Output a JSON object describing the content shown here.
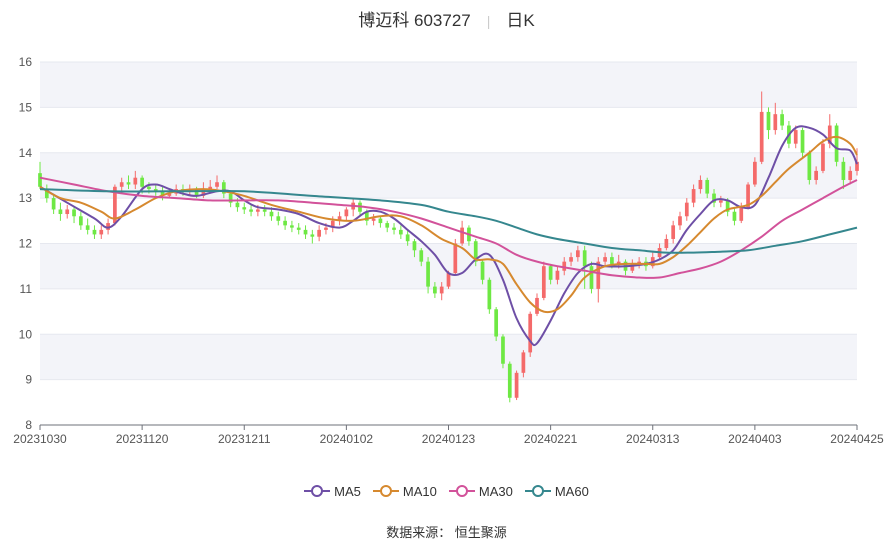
{
  "header": {
    "name": "博迈科",
    "code": "603727",
    "period": "日K"
  },
  "source": "数据来源： 恒生聚源",
  "colors": {
    "up": "#f46a6a",
    "down": "#6ee844",
    "band": "#f3f4f9",
    "grid": "#e6e8ef"
  },
  "chart_data": {
    "type": "candlestick",
    "ylim": [
      8,
      16
    ],
    "yticks": [
      8,
      9,
      10,
      11,
      12,
      13,
      14,
      15,
      16
    ],
    "xlabels": [
      "20231030",
      "20231120",
      "20231211",
      "20240102",
      "20240123",
      "20240221",
      "20240313",
      "20240403",
      "20240425"
    ],
    "xlabel_index": [
      0,
      15,
      30,
      45,
      60,
      75,
      90,
      105,
      120
    ],
    "n_days": 121,
    "candles": [
      [
        13.55,
        13.25,
        13.8,
        13.2
      ],
      [
        13.2,
        13.0,
        13.3,
        12.9
      ],
      [
        13.0,
        12.75,
        13.1,
        12.65
      ],
      [
        12.75,
        12.65,
        12.9,
        12.5
      ],
      [
        12.65,
        12.75,
        12.85,
        12.55
      ],
      [
        12.75,
        12.6,
        12.8,
        12.45
      ],
      [
        12.6,
        12.4,
        12.7,
        12.3
      ],
      [
        12.4,
        12.3,
        12.55,
        12.2
      ],
      [
        12.3,
        12.2,
        12.4,
        12.1
      ],
      [
        12.2,
        12.3,
        12.4,
        12.1
      ],
      [
        12.3,
        12.45,
        12.55,
        12.2
      ],
      [
        12.45,
        13.25,
        13.3,
        12.4
      ],
      [
        13.25,
        13.35,
        13.45,
        13.1
      ],
      [
        13.35,
        13.3,
        13.5,
        13.2
      ],
      [
        13.3,
        13.45,
        13.6,
        13.2
      ],
      [
        13.45,
        13.25,
        13.5,
        13.1
      ],
      [
        13.25,
        13.2,
        13.35,
        13.1
      ],
      [
        13.2,
        13.15,
        13.3,
        13.05
      ],
      [
        13.15,
        13.05,
        13.25,
        12.95
      ],
      [
        13.05,
        13.1,
        13.2,
        13.0
      ],
      [
        13.1,
        13.2,
        13.3,
        13.05
      ],
      [
        13.2,
        13.15,
        13.3,
        13.05
      ],
      [
        13.15,
        13.2,
        13.3,
        13.05
      ],
      [
        13.2,
        13.05,
        13.25,
        13.0
      ],
      [
        13.05,
        13.2,
        13.35,
        13.0
      ],
      [
        13.2,
        13.25,
        13.4,
        13.1
      ],
      [
        13.25,
        13.35,
        13.5,
        13.2
      ],
      [
        13.35,
        13.1,
        13.4,
        13.0
      ],
      [
        13.1,
        12.9,
        13.15,
        12.8
      ],
      [
        12.9,
        12.8,
        13.0,
        12.7
      ],
      [
        12.8,
        12.75,
        12.9,
        12.65
      ],
      [
        12.75,
        12.7,
        12.85,
        12.6
      ],
      [
        12.7,
        12.75,
        12.85,
        12.6
      ],
      [
        12.75,
        12.7,
        12.85,
        12.6
      ],
      [
        12.7,
        12.6,
        12.8,
        12.5
      ],
      [
        12.6,
        12.5,
        12.7,
        12.4
      ],
      [
        12.5,
        12.4,
        12.6,
        12.3
      ],
      [
        12.4,
        12.35,
        12.5,
        12.25
      ],
      [
        12.35,
        12.3,
        12.45,
        12.2
      ],
      [
        12.3,
        12.2,
        12.4,
        12.1
      ],
      [
        12.2,
        12.15,
        12.3,
        12.0
      ],
      [
        12.15,
        12.3,
        12.4,
        12.05
      ],
      [
        12.3,
        12.35,
        12.45,
        12.2
      ],
      [
        12.35,
        12.5,
        12.6,
        12.25
      ],
      [
        12.5,
        12.6,
        12.7,
        12.4
      ],
      [
        12.6,
        12.75,
        12.8,
        12.5
      ],
      [
        12.75,
        12.9,
        13.0,
        12.6
      ],
      [
        12.9,
        12.7,
        12.95,
        12.6
      ],
      [
        12.7,
        12.5,
        12.75,
        12.4
      ],
      [
        12.5,
        12.55,
        12.65,
        12.4
      ],
      [
        12.55,
        12.45,
        12.6,
        12.35
      ],
      [
        12.45,
        12.35,
        12.5,
        12.25
      ],
      [
        12.35,
        12.3,
        12.45,
        12.2
      ],
      [
        12.3,
        12.2,
        12.4,
        12.1
      ],
      [
        12.2,
        12.05,
        12.3,
        11.95
      ],
      [
        12.05,
        11.85,
        12.1,
        11.7
      ],
      [
        11.85,
        11.6,
        11.9,
        11.5
      ],
      [
        11.6,
        11.05,
        11.7,
        10.9
      ],
      [
        11.05,
        10.9,
        11.15,
        10.8
      ],
      [
        10.9,
        11.05,
        11.15,
        10.75
      ],
      [
        11.05,
        11.35,
        11.4,
        11.0
      ],
      [
        11.35,
        12.0,
        12.1,
        11.3
      ],
      [
        12.0,
        12.35,
        12.5,
        11.95
      ],
      [
        12.35,
        12.05,
        12.4,
        11.95
      ],
      [
        12.05,
        11.6,
        12.1,
        11.5
      ],
      [
        11.6,
        11.2,
        11.65,
        11.1
      ],
      [
        11.2,
        10.55,
        11.25,
        10.45
      ],
      [
        10.55,
        9.95,
        10.6,
        9.85
      ],
      [
        9.95,
        9.35,
        10.0,
        9.25
      ],
      [
        9.35,
        8.6,
        9.4,
        8.5
      ],
      [
        8.6,
        9.15,
        9.2,
        8.55
      ],
      [
        9.15,
        9.6,
        9.65,
        9.05
      ],
      [
        9.6,
        10.45,
        10.5,
        9.5
      ],
      [
        10.45,
        10.8,
        10.9,
        10.4
      ],
      [
        10.8,
        11.5,
        11.6,
        10.75
      ],
      [
        11.5,
        11.2,
        11.55,
        11.1
      ],
      [
        11.2,
        11.4,
        11.5,
        11.1
      ],
      [
        11.4,
        11.6,
        11.7,
        11.3
      ],
      [
        11.6,
        11.7,
        11.8,
        11.5
      ],
      [
        11.7,
        11.85,
        11.95,
        11.6
      ],
      [
        11.85,
        11.5,
        11.95,
        11.0
      ],
      [
        11.5,
        11.0,
        11.6,
        10.9
      ],
      [
        11.0,
        11.6,
        11.7,
        10.7
      ],
      [
        11.6,
        11.7,
        11.8,
        11.5
      ],
      [
        11.7,
        11.55,
        11.8,
        11.45
      ],
      [
        11.55,
        11.6,
        11.75,
        11.45
      ],
      [
        11.6,
        11.4,
        11.65,
        11.3
      ],
      [
        11.4,
        11.55,
        11.65,
        11.35
      ],
      [
        11.55,
        11.6,
        11.7,
        11.45
      ],
      [
        11.6,
        11.5,
        11.7,
        11.4
      ],
      [
        11.5,
        11.7,
        11.8,
        11.45
      ],
      [
        11.7,
        11.9,
        12.0,
        11.65
      ],
      [
        11.9,
        12.1,
        12.2,
        11.85
      ],
      [
        12.1,
        12.4,
        12.5,
        12.0
      ],
      [
        12.4,
        12.6,
        12.7,
        12.3
      ],
      [
        12.6,
        12.9,
        13.0,
        12.5
      ],
      [
        12.9,
        13.2,
        13.3,
        12.8
      ],
      [
        13.2,
        13.4,
        13.5,
        13.1
      ],
      [
        13.4,
        13.1,
        13.45,
        13.0
      ],
      [
        13.1,
        12.9,
        13.2,
        12.8
      ],
      [
        12.9,
        12.95,
        13.05,
        12.8
      ],
      [
        12.95,
        12.7,
        13.0,
        12.6
      ],
      [
        12.7,
        12.5,
        12.8,
        12.4
      ],
      [
        12.5,
        12.8,
        12.9,
        12.45
      ],
      [
        12.8,
        13.3,
        13.35,
        12.75
      ],
      [
        13.3,
        13.8,
        13.9,
        13.25
      ],
      [
        13.8,
        14.9,
        15.35,
        13.75
      ],
      [
        14.9,
        14.5,
        15.0,
        14.3
      ],
      [
        14.5,
        14.85,
        15.1,
        14.4
      ],
      [
        14.85,
        14.6,
        14.95,
        14.5
      ],
      [
        14.6,
        14.2,
        14.7,
        14.1
      ],
      [
        14.2,
        14.5,
        14.6,
        14.1
      ],
      [
        14.5,
        14.0,
        14.55,
        13.9
      ],
      [
        14.0,
        13.4,
        14.05,
        13.3
      ],
      [
        13.4,
        13.6,
        13.7,
        13.3
      ],
      [
        13.6,
        14.2,
        14.3,
        13.55
      ],
      [
        14.2,
        14.6,
        14.85,
        14.1
      ],
      [
        14.6,
        13.8,
        14.65,
        13.7
      ],
      [
        13.8,
        13.4,
        13.9,
        13.2
      ],
      [
        13.4,
        13.6,
        13.7,
        13.3
      ],
      [
        13.6,
        13.8,
        14.1,
        13.5
      ]
    ],
    "series": [
      {
        "name": "MA5",
        "color": "#6e4fa6",
        "values": [
          [
            0,
            13.25
          ],
          [
            4,
            12.9
          ],
          [
            8,
            12.55
          ],
          [
            10,
            12.35
          ],
          [
            12,
            12.6
          ],
          [
            15,
            13.2
          ],
          [
            17,
            13.3
          ],
          [
            19,
            13.2
          ],
          [
            21,
            13.1
          ],
          [
            23,
            13.05
          ],
          [
            26,
            13.15
          ],
          [
            28,
            13.15
          ],
          [
            30,
            12.95
          ],
          [
            32,
            12.8
          ],
          [
            35,
            12.75
          ],
          [
            38,
            12.65
          ],
          [
            41,
            12.45
          ],
          [
            44,
            12.35
          ],
          [
            46,
            12.5
          ],
          [
            48,
            12.7
          ],
          [
            50,
            12.7
          ],
          [
            52,
            12.55
          ],
          [
            54,
            12.3
          ],
          [
            56,
            12.05
          ],
          [
            58,
            11.75
          ],
          [
            60,
            11.35
          ],
          [
            62,
            11.35
          ],
          [
            64,
            11.65
          ],
          [
            66,
            11.75
          ],
          [
            68,
            11.2
          ],
          [
            70,
            10.35
          ],
          [
            72,
            9.85
          ],
          [
            73,
            9.8
          ],
          [
            75,
            10.3
          ],
          [
            77,
            10.9
          ],
          [
            79,
            11.35
          ],
          [
            81,
            11.55
          ],
          [
            83,
            11.5
          ],
          [
            86,
            11.5
          ],
          [
            89,
            11.55
          ],
          [
            91,
            11.65
          ],
          [
            93,
            11.85
          ],
          [
            95,
            12.3
          ],
          [
            97,
            12.65
          ],
          [
            99,
            12.95
          ],
          [
            101,
            12.95
          ],
          [
            103,
            12.8
          ],
          [
            105,
            12.85
          ],
          [
            107,
            13.45
          ],
          [
            109,
            14.15
          ],
          [
            111,
            14.55
          ],
          [
            113,
            14.55
          ],
          [
            115,
            14.4
          ],
          [
            117,
            14.1
          ],
          [
            119,
            14.05
          ],
          [
            120,
            13.75
          ]
        ]
      },
      {
        "name": "MA10",
        "color": "#d6892f",
        "values": [
          [
            0,
            13.25
          ],
          [
            3,
            13.0
          ],
          [
            6,
            12.9
          ],
          [
            9,
            12.7
          ],
          [
            11,
            12.55
          ],
          [
            14,
            12.75
          ],
          [
            17,
            13.0
          ],
          [
            20,
            13.15
          ],
          [
            24,
            13.2
          ],
          [
            27,
            13.15
          ],
          [
            30,
            13.05
          ],
          [
            34,
            12.85
          ],
          [
            38,
            12.7
          ],
          [
            42,
            12.55
          ],
          [
            46,
            12.5
          ],
          [
            50,
            12.6
          ],
          [
            53,
            12.6
          ],
          [
            56,
            12.4
          ],
          [
            59,
            12.1
          ],
          [
            62,
            11.9
          ],
          [
            64,
            11.65
          ],
          [
            66,
            11.65
          ],
          [
            68,
            11.55
          ],
          [
            70,
            11.1
          ],
          [
            72,
            10.7
          ],
          [
            74,
            10.5
          ],
          [
            76,
            10.55
          ],
          [
            78,
            10.85
          ],
          [
            80,
            11.25
          ],
          [
            83,
            11.5
          ],
          [
            86,
            11.55
          ],
          [
            89,
            11.55
          ],
          [
            91,
            11.55
          ],
          [
            93,
            11.7
          ],
          [
            95,
            11.95
          ],
          [
            97,
            12.25
          ],
          [
            99,
            12.55
          ],
          [
            101,
            12.75
          ],
          [
            104,
            12.85
          ],
          [
            106,
            13.05
          ],
          [
            108,
            13.35
          ],
          [
            110,
            13.65
          ],
          [
            113,
            14.0
          ],
          [
            115,
            14.25
          ],
          [
            117,
            14.35
          ],
          [
            119,
            14.2
          ],
          [
            120,
            13.95
          ]
        ]
      },
      {
        "name": "MA30",
        "color": "#d2529a",
        "values": [
          [
            0,
            13.45
          ],
          [
            5,
            13.3
          ],
          [
            10,
            13.15
          ],
          [
            15,
            13.05
          ],
          [
            20,
            13.0
          ],
          [
            25,
            12.95
          ],
          [
            30,
            12.95
          ],
          [
            35,
            12.95
          ],
          [
            40,
            12.9
          ],
          [
            44,
            12.85
          ],
          [
            48,
            12.8
          ],
          [
            52,
            12.7
          ],
          [
            56,
            12.55
          ],
          [
            60,
            12.35
          ],
          [
            64,
            12.15
          ],
          [
            67,
            12.0
          ],
          [
            70,
            11.75
          ],
          [
            73,
            11.6
          ],
          [
            76,
            11.5
          ],
          [
            80,
            11.4
          ],
          [
            84,
            11.3
          ],
          [
            88,
            11.25
          ],
          [
            91,
            11.25
          ],
          [
            94,
            11.35
          ],
          [
            97,
            11.45
          ],
          [
            100,
            11.6
          ],
          [
            103,
            11.85
          ],
          [
            106,
            12.15
          ],
          [
            109,
            12.5
          ],
          [
            112,
            12.75
          ],
          [
            115,
            13.0
          ],
          [
            118,
            13.25
          ],
          [
            120,
            13.4
          ]
        ]
      },
      {
        "name": "MA60",
        "color": "#35878e",
        "values": [
          [
            0,
            13.2
          ],
          [
            10,
            13.15
          ],
          [
            20,
            13.15
          ],
          [
            30,
            13.15
          ],
          [
            40,
            13.05
          ],
          [
            50,
            12.95
          ],
          [
            56,
            12.85
          ],
          [
            60,
            12.7
          ],
          [
            64,
            12.6
          ],
          [
            67,
            12.5
          ],
          [
            70,
            12.35
          ],
          [
            73,
            12.2
          ],
          [
            76,
            12.1
          ],
          [
            80,
            12.0
          ],
          [
            84,
            11.9
          ],
          [
            88,
            11.85
          ],
          [
            92,
            11.8
          ],
          [
            96,
            11.8
          ],
          [
            100,
            11.82
          ],
          [
            104,
            11.85
          ],
          [
            108,
            11.95
          ],
          [
            112,
            12.05
          ],
          [
            116,
            12.2
          ],
          [
            120,
            12.35
          ]
        ]
      }
    ]
  }
}
